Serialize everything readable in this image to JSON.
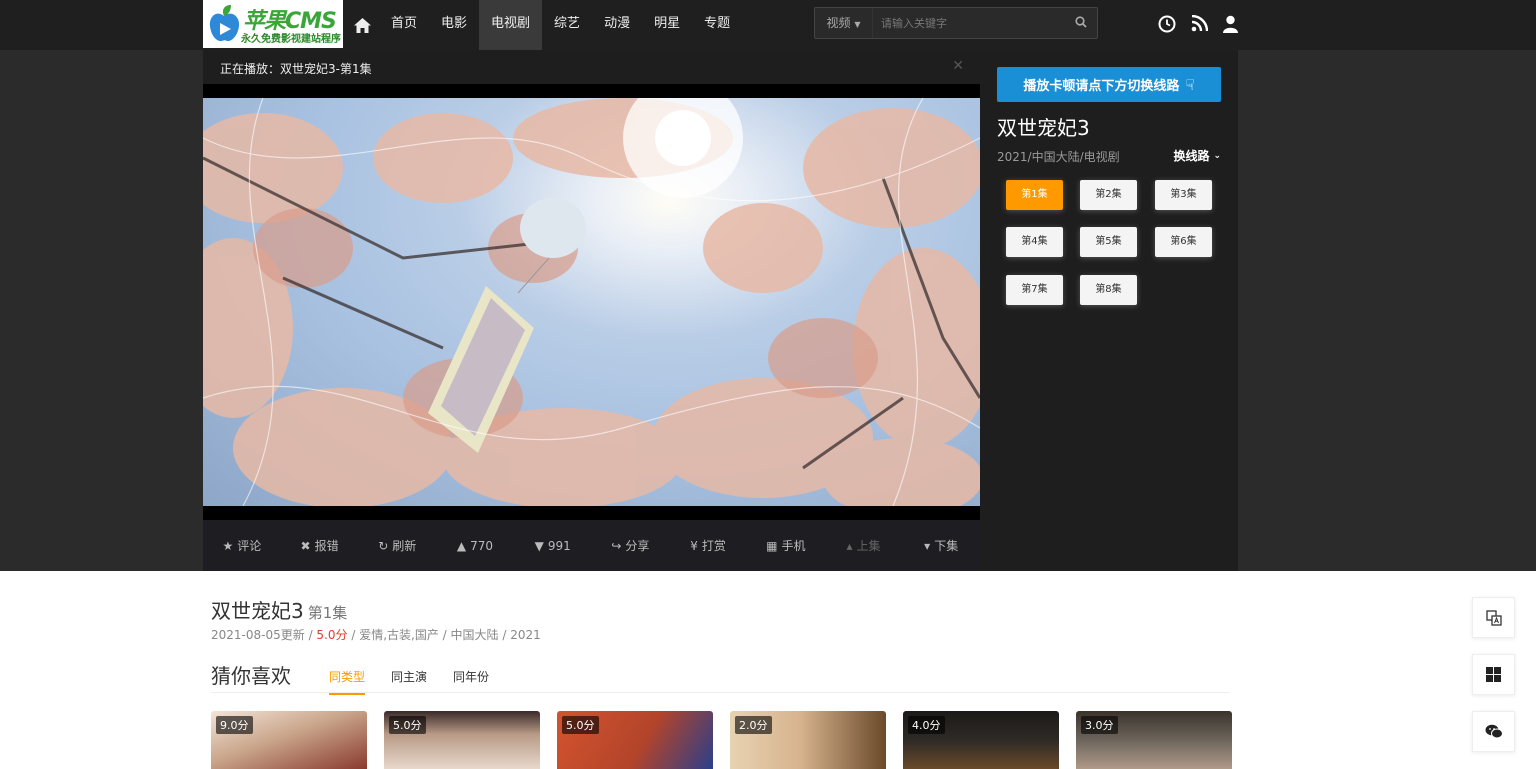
{
  "header": {
    "logo_main": "苹果CMS",
    "logo_sub": "永久免费影视建站程序",
    "nav": [
      {
        "label": "首页",
        "active": false
      },
      {
        "label": "电影",
        "active": false
      },
      {
        "label": "电视剧",
        "active": true
      },
      {
        "label": "综艺",
        "active": false
      },
      {
        "label": "动漫",
        "active": false
      },
      {
        "label": "明星",
        "active": false
      },
      {
        "label": "专题",
        "active": false
      }
    ],
    "search": {
      "category": "视频",
      "placeholder": "请输入关键字"
    },
    "icons": [
      "home-icon",
      "search-icon",
      "history-clock-icon",
      "rss-icon",
      "user-icon"
    ]
  },
  "player": {
    "now_playing": "正在播放：双世宠妃3-第1集",
    "controls": [
      {
        "label": "评论",
        "icon": "star-icon"
      },
      {
        "label": "报错",
        "icon": "close-icon"
      },
      {
        "label": "刷新",
        "icon": "refresh-icon"
      },
      {
        "label": "770",
        "icon": "thumbs-up-icon"
      },
      {
        "label": "991",
        "icon": "thumbs-down-icon"
      },
      {
        "label": "分享",
        "icon": "share-icon"
      },
      {
        "label": "打赏",
        "icon": "yen-icon"
      },
      {
        "label": "手机",
        "icon": "qrcode-icon"
      },
      {
        "label": "上集",
        "icon": "caret-up-icon"
      },
      {
        "label": "下集",
        "icon": "caret-down-icon"
      }
    ]
  },
  "side": {
    "tip_button": "播放卡顿请点下方切换线路",
    "title": "双世宠妃3",
    "meta": "2021/中国大陆/电视剧",
    "switch_line": "换线路",
    "episodes": [
      "第1集",
      "第2集",
      "第3集",
      "第4集",
      "第5集",
      "第6集",
      "第7集",
      "第8集"
    ],
    "active_episode": 0
  },
  "info": {
    "title": "双世宠妃3",
    "episode": "第1集",
    "updated": "2021-08-05更新",
    "score": "5.0分",
    "genres": "爱情,古装,国产",
    "region": "中国大陆",
    "year": "2021"
  },
  "guess": {
    "heading": "猜你喜欢",
    "tabs": [
      {
        "label": "同类型",
        "active": true
      },
      {
        "label": "同主演",
        "active": false
      },
      {
        "label": "同年份",
        "active": false
      }
    ],
    "cards": [
      {
        "score": "9.0分",
        "color": "#c9a58a"
      },
      {
        "score": "5.0分",
        "color": "#b89a86"
      },
      {
        "score": "5.0分",
        "color": "#b3442a"
      },
      {
        "score": "2.0分",
        "color": "#d7b38e"
      },
      {
        "score": "4.0分",
        "color": "#2e2a26"
      },
      {
        "score": "3.0分",
        "color": "#6d655c"
      }
    ]
  },
  "floating_tools": [
    "translate-icon",
    "windows-icon",
    "wechat-icon"
  ],
  "colors": {
    "accent": "#ff9900",
    "tip_blue": "#1a8fd6",
    "score_red": "#e53c2e",
    "header_bg": "#1f1f1f"
  }
}
